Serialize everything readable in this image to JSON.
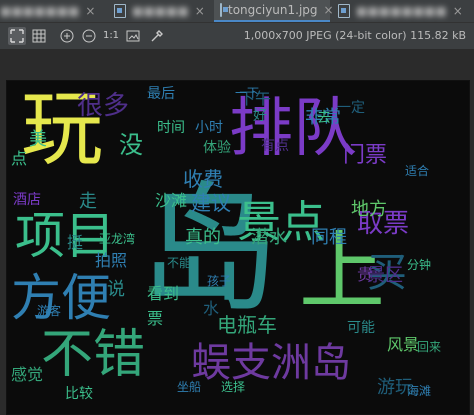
{
  "tabs": [
    {
      "title": "■■■■■■■",
      "active": false
    },
    {
      "title": "■■■■■",
      "active": false
    },
    {
      "title": "tongciyun1.jpg",
      "active": true
    },
    {
      "title": "■■■■■■■■",
      "active": false
    }
  ],
  "tab_close_glyph": "×",
  "toolbar": {
    "fit_icon": "fit-screen-icon",
    "grid_icon": "grid-icon",
    "zoom_in": "+",
    "zoom_out": "−",
    "actual_size": "1:1",
    "frame_icon": "frame-icon",
    "color_picker_icon": "eyedropper-icon"
  },
  "image_info": "1,000x700 JPEG (24-bit color) 115.82 kB",
  "wordcloud": {
    "words": [
      "玩",
      "排队",
      "项目",
      "方便",
      "不错",
      "岛",
      "上",
      "景点",
      "买",
      "蜈支洲岛",
      "很多",
      "没",
      "收费",
      "取票",
      "门票",
      "沙滩",
      "建议",
      "真的",
      "潜水",
      "同程",
      "贵",
      "景区",
      "拍照",
      "电瓶车",
      "风景",
      "游玩",
      "地方",
      "美",
      "走",
      "酒店",
      "挺",
      "说",
      "看到",
      "感觉",
      "比较",
      "坐船",
      "选择",
      "下午",
      "非常",
      "好",
      "一下",
      "有点",
      "游客",
      "孩子",
      "不能",
      "亚龙湾",
      "小时",
      "体验",
      "分钟",
      "海滩",
      "水",
      "票",
      "点",
      "最后",
      "可能",
      "时间",
      "一定",
      "去",
      "适合",
      "回来"
    ],
    "colors": [
      "#e6e84d",
      "#7b3bc7",
      "#3bbf8c",
      "#2f7fb2",
      "#34a67a",
      "#2a8a8a",
      "#5fc86b",
      "#1f5e7a",
      "#6e3aa0",
      "#4f2f8a"
    ]
  }
}
